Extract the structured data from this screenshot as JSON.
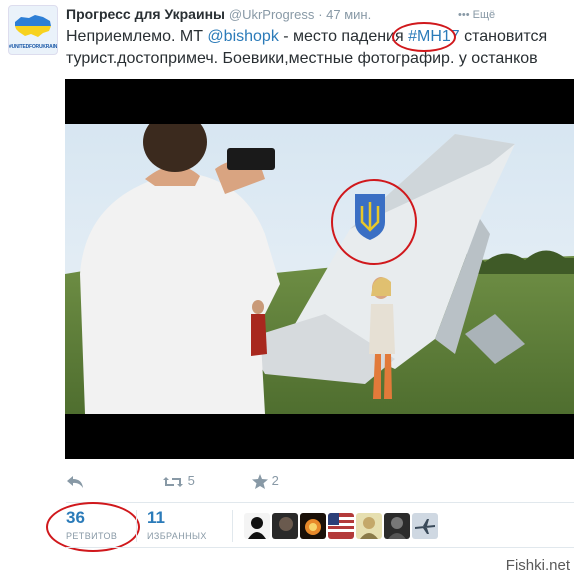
{
  "account": {
    "name": "Прогресс для Украины",
    "handle": "@UkrProgress",
    "time": "· 47 мин.",
    "more": "••• Ещё",
    "avatar_tag": "#UNITEDFORUKRAINE"
  },
  "tweet": {
    "text_1": "Неприемлемо. МТ ",
    "mention": "@bishopk",
    "text_2": " - место падения ",
    "hashtag": "#MH17",
    "text_3": " становится",
    "line_2": "турист.достопримеч. Боевики,местные фотографир. у останков"
  },
  "actions": {
    "reply_icon": "reply-icon",
    "retweet_icon": "retweet-icon",
    "retweet_count": "5",
    "favorite_icon": "star-icon",
    "favorite_count": "2"
  },
  "stats": {
    "retweets": "36",
    "retweets_label": "РЕТВИТОВ",
    "favorites": "11",
    "favorites_label": "ИЗБРАННЫХ"
  },
  "colors": {
    "link": "#2b7bb9",
    "muted": "#8899a6",
    "annotation": "#d0181c"
  },
  "watermark": "Fishki.net"
}
